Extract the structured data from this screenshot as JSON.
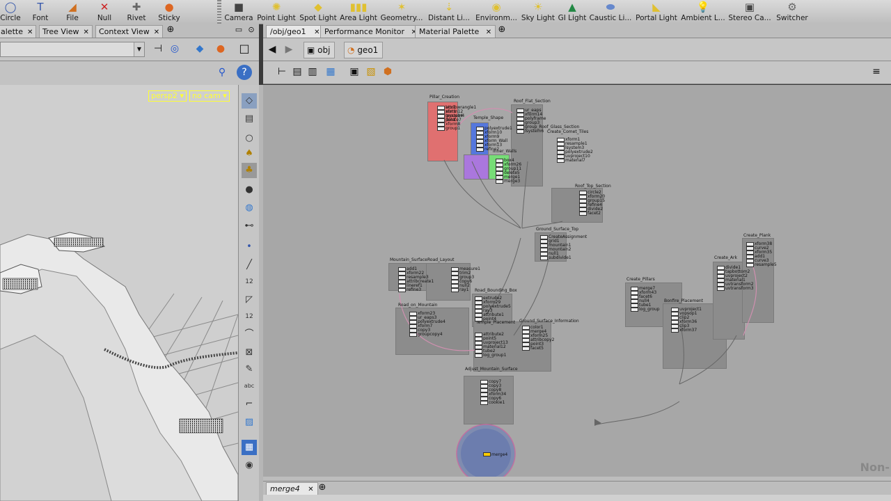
{
  "shelf": {
    "left_tools": [
      {
        "label": "Circle",
        "icon": "circle-icon"
      },
      {
        "label": "Font",
        "icon": "font-icon"
      },
      {
        "label": "File",
        "icon": "file-icon"
      },
      {
        "label": "Null",
        "icon": "null-icon"
      },
      {
        "label": "Rivet",
        "icon": "rivet-icon"
      },
      {
        "label": "Sticky",
        "icon": "sticky-icon"
      }
    ],
    "right_tools": [
      {
        "label": "Camera",
        "icon": "camera-icon"
      },
      {
        "label": "Point Light",
        "icon": "point-light-icon"
      },
      {
        "label": "Spot Light",
        "icon": "spot-light-icon"
      },
      {
        "label": "Area Light",
        "icon": "area-light-icon"
      },
      {
        "label": "Geometry...",
        "icon": "geometry-light-icon"
      },
      {
        "label": "Distant Li...",
        "icon": "distant-light-icon"
      },
      {
        "label": "Environm...",
        "icon": "environment-light-icon"
      },
      {
        "label": "Sky Light",
        "icon": "sky-light-icon"
      },
      {
        "label": "GI Light",
        "icon": "gi-light-icon"
      },
      {
        "label": "Caustic Li...",
        "icon": "caustic-light-icon"
      },
      {
        "label": "Portal Light",
        "icon": "portal-light-icon"
      },
      {
        "label": "Ambient L...",
        "icon": "ambient-light-icon"
      },
      {
        "label": "Stereo Ca...",
        "icon": "stereo-camera-icon"
      },
      {
        "label": "Switcher",
        "icon": "switcher-icon"
      }
    ]
  },
  "left_panel": {
    "tabs": [
      {
        "label": "alette"
      },
      {
        "label": "Tree View"
      },
      {
        "label": "Context View"
      }
    ],
    "viewport": {
      "camera_chip": "persp2",
      "cam_chip": "no cam"
    }
  },
  "right_panel": {
    "tabs": [
      {
        "label": "/obj/geo1",
        "active": true
      },
      {
        "label": "Performance Monitor",
        "active": false
      },
      {
        "label": "Material Palette",
        "active": false
      }
    ],
    "path": [
      {
        "label": "obj"
      },
      {
        "label": "geo1"
      }
    ],
    "network": {
      "groups": [
        {
          "title": "Pillar_Creation"
        },
        {
          "title": "Temple_Shape"
        },
        {
          "title": "Roof_Flat_Section"
        },
        {
          "title": "Create_Comet_Tiles"
        },
        {
          "title": "Inner_Walls"
        },
        {
          "title": "Roof_Top_Section"
        },
        {
          "title": "Ground_Surface_Top"
        },
        {
          "title": "Mountain_Surface"
        },
        {
          "title": "Road_Layout"
        },
        {
          "title": "Road_Bounding_Box"
        },
        {
          "title": "Road_on_Mountain"
        },
        {
          "title": "Ground_Surface_Information"
        },
        {
          "title": "Temple_Placement"
        },
        {
          "title": "Adjust_Mountain_Surface"
        },
        {
          "title": "Create_Pillars"
        },
        {
          "title": "Bonfire_Placement"
        },
        {
          "title": "Create_Ark"
        },
        {
          "title": "Create_Plank"
        }
      ],
      "nodes": [
        "box1",
        "xform12",
        "lsystem4",
        "join1",
        "xform8",
        "group1",
        "polyextrude1",
        "xform10",
        "xform9",
        "xform_Wall",
        "xform13",
        "refine2",
        "ur_eaps",
        "xform14",
        "polyframe",
        "group3",
        "group_Roof_Glass_Section",
        "lsystem6",
        "xform1",
        "resample1",
        "lsystem3",
        "polyextrude2",
        "uvproject10",
        "material7",
        "box4",
        "xform26",
        "group11",
        "delete5",
        "merge1",
        "merge3",
        "circle2",
        "xform20",
        "group15",
        "refine4",
        "divide2",
        "facet2",
        "CreateAssignment",
        "grid1",
        "mountain1",
        "mountain2",
        "null1",
        "subdivide1",
        "add1",
        "xform22",
        "resample3",
        "attribcreate1",
        "lineref1",
        "refine3",
        "measure1",
        "trim2",
        "group3",
        "copy6",
        "null2",
        "ray1",
        "xform23",
        "ur_eaps3",
        "polyextrude4",
        "xform7",
        "copy3",
        "groupcopy4",
        "extrude2",
        "xform29",
        "polyextrude5",
        "ray3",
        "attribute1",
        "point4",
        "color1",
        "merge4",
        "xform25",
        "attribcopy2",
        "point3",
        "facet5",
        "attribute2",
        "point5",
        "uvproject13",
        "material12",
        "tube2",
        "log_group1",
        "copy7",
        "copy3",
        "copy8",
        "xform34",
        "copy6",
        "cookie1",
        "merge7",
        "xform43",
        "facet6",
        "null4",
        "tube1",
        "log_group",
        "uvproject1",
        "vopsop1",
        "clip2",
        "xform36",
        "clip3",
        "xform37",
        "divide1",
        "tapbottom2",
        "uvproject2",
        "material1",
        "uvtransform2",
        "uvtransform3",
        "xform38",
        "curve2",
        "xform35",
        "add1",
        "curve3",
        "resample5",
        "attribwrangle1",
        "sort1",
        "group14",
        "delete7"
      ],
      "watermark": "Non-"
    },
    "bottom_tabs": [
      {
        "label": "merge4"
      }
    ]
  },
  "colors": {
    "chrome_bg": "#c6c6c6",
    "network_bg": "#a7a7a7",
    "viewport_bg": "#cfcfcf",
    "chip_yellow": "#ffff33"
  }
}
